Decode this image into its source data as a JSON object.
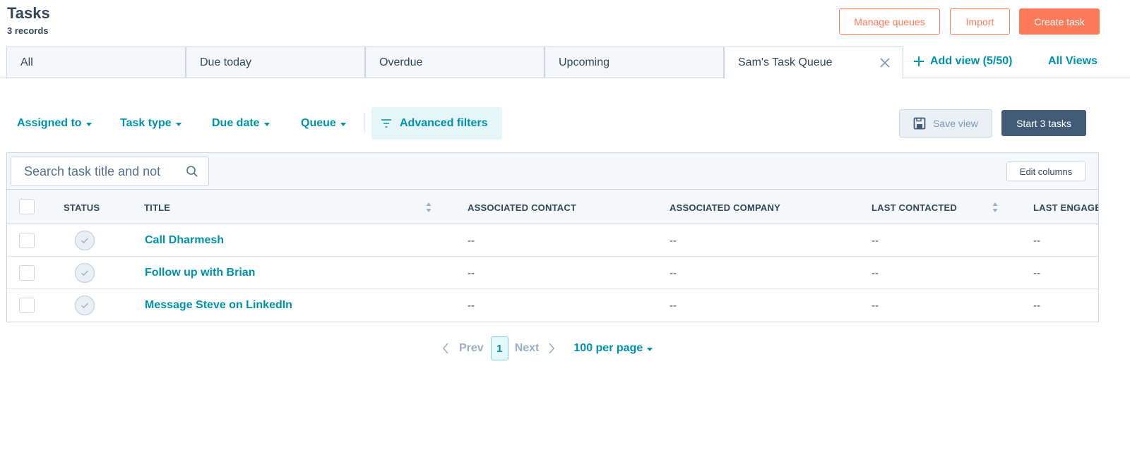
{
  "header": {
    "title": "Tasks",
    "record_count": "3 records",
    "buttons": {
      "manage_queues": "Manage queues",
      "import": "Import",
      "create_task": "Create task"
    }
  },
  "tabs": [
    {
      "label": "All"
    },
    {
      "label": "Due today"
    },
    {
      "label": "Overdue"
    },
    {
      "label": "Upcoming"
    },
    {
      "label": "Sam's Task Queue",
      "active": true
    }
  ],
  "add_view_label": "Add view (5/50)",
  "all_views_label": "All Views",
  "filters": {
    "assigned_to": "Assigned to",
    "task_type": "Task type",
    "due_date": "Due date",
    "queue": "Queue",
    "advanced": "Advanced filters"
  },
  "actions": {
    "save_view": "Save view",
    "start_tasks": "Start 3 tasks"
  },
  "table": {
    "search_placeholder": "Search task title and not",
    "edit_columns": "Edit columns",
    "columns": {
      "status": "STATUS",
      "title": "TITLE",
      "associated_contact": "ASSOCIATED CONTACT",
      "associated_company": "ASSOCIATED COMPANY",
      "last_contacted": "LAST CONTACTED",
      "last_engaged": "LAST ENGAGE"
    },
    "rows": [
      {
        "title": "Call Dharmesh",
        "contact": "--",
        "company": "--",
        "last_contacted": "--",
        "last_engaged": "--"
      },
      {
        "title": "Follow up with Brian",
        "contact": "--",
        "company": "--",
        "last_contacted": "--",
        "last_engaged": "--"
      },
      {
        "title": "Message Steve on LinkedIn",
        "contact": "--",
        "company": "--",
        "last_contacted": "--",
        "last_engaged": "--"
      }
    ]
  },
  "pagination": {
    "prev": "Prev",
    "current": "1",
    "next": "Next",
    "per_page": "100 per page"
  },
  "colors": {
    "accent_orange": "#ff7a59",
    "link_teal": "#0091ae",
    "dark_slate": "#425b76",
    "text": "#33475b"
  }
}
